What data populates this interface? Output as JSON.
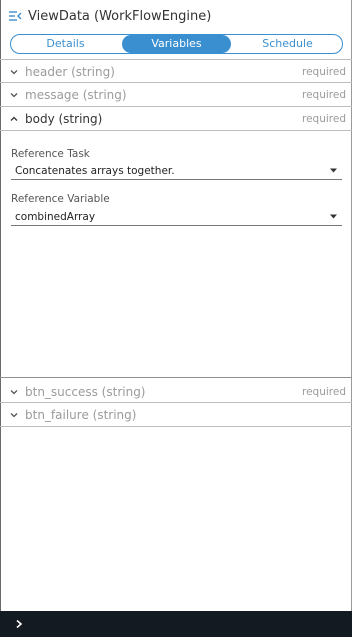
{
  "header": {
    "title": "ViewData (WorkFlowEngine)",
    "back_icon": "collapse-menu-icon"
  },
  "tabs": [
    {
      "label": "Details",
      "active": false
    },
    {
      "label": "Variables",
      "active": true
    },
    {
      "label": "Schedule",
      "active": false
    }
  ],
  "variables": [
    {
      "label": "header (string)",
      "required": "required",
      "expanded": false
    },
    {
      "label": "message (string)",
      "required": "required",
      "expanded": false
    },
    {
      "label": "body (string)",
      "required": "required",
      "expanded": true
    },
    {
      "label": "btn_success (string)",
      "required": "required",
      "expanded": false
    },
    {
      "label": "btn_failure (string)",
      "required": "",
      "expanded": false
    }
  ],
  "body_panel": {
    "reference_task_label": "Reference Task",
    "reference_task_value": "Concatenates arrays together.",
    "reference_variable_label": "Reference Variable",
    "reference_variable_value": "combinedArray"
  },
  "colors": {
    "accent": "#3a8fd0",
    "bottom_bar": "#141a22",
    "muted_text": "#9b9b9b"
  }
}
